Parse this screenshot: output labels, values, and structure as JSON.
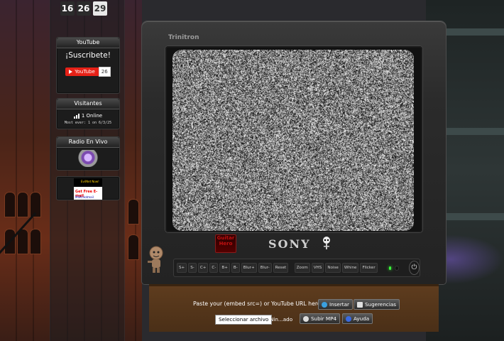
{
  "calendar": {
    "days": [
      "16",
      "26",
      "29"
    ]
  },
  "youtube_widget": {
    "title": "YouTube",
    "subscribe_text": "¡Suscribete!",
    "button_label": "YouTube",
    "subscriber_count": "26"
  },
  "visitors_widget": {
    "title": "Visitantes",
    "online_text": "1 Online",
    "most_ever_text": "Most ever: 1 on 6/3/25"
  },
  "radio_widget": {
    "title": "Radio En Vivo"
  },
  "ad_widget": {
    "lines": [
      "EvilNet Now!",
      "Get Free E-mail",
      "MSN Hotmail"
    ]
  },
  "tv": {
    "top_label": "Trinitron",
    "brand": "SONY",
    "gh_logo_text": "Guitar Hero",
    "controls": [
      "S+",
      "S-",
      "C+",
      "C-",
      "B+",
      "B-",
      "Blur+",
      "Blur-",
      "Reset",
      "Zoom",
      "VHS",
      "Noise",
      "Whine",
      "Flicker"
    ],
    "power_symbol": "⏻"
  },
  "stand": {
    "url_prompt": "Paste your (embed src=) or YouTube URL here:",
    "insert_button": "Insertar",
    "suggest_button": "Sugerencias",
    "file_button": "Seleccionar archivo",
    "file_status": "Nin...ado",
    "upload_button": "Subir MP4",
    "help_button": "Ayuda"
  },
  "colors": {
    "led_on": "#3cff3c",
    "yt_red": "#e62117",
    "stand_wood": "#5e3c1e"
  }
}
